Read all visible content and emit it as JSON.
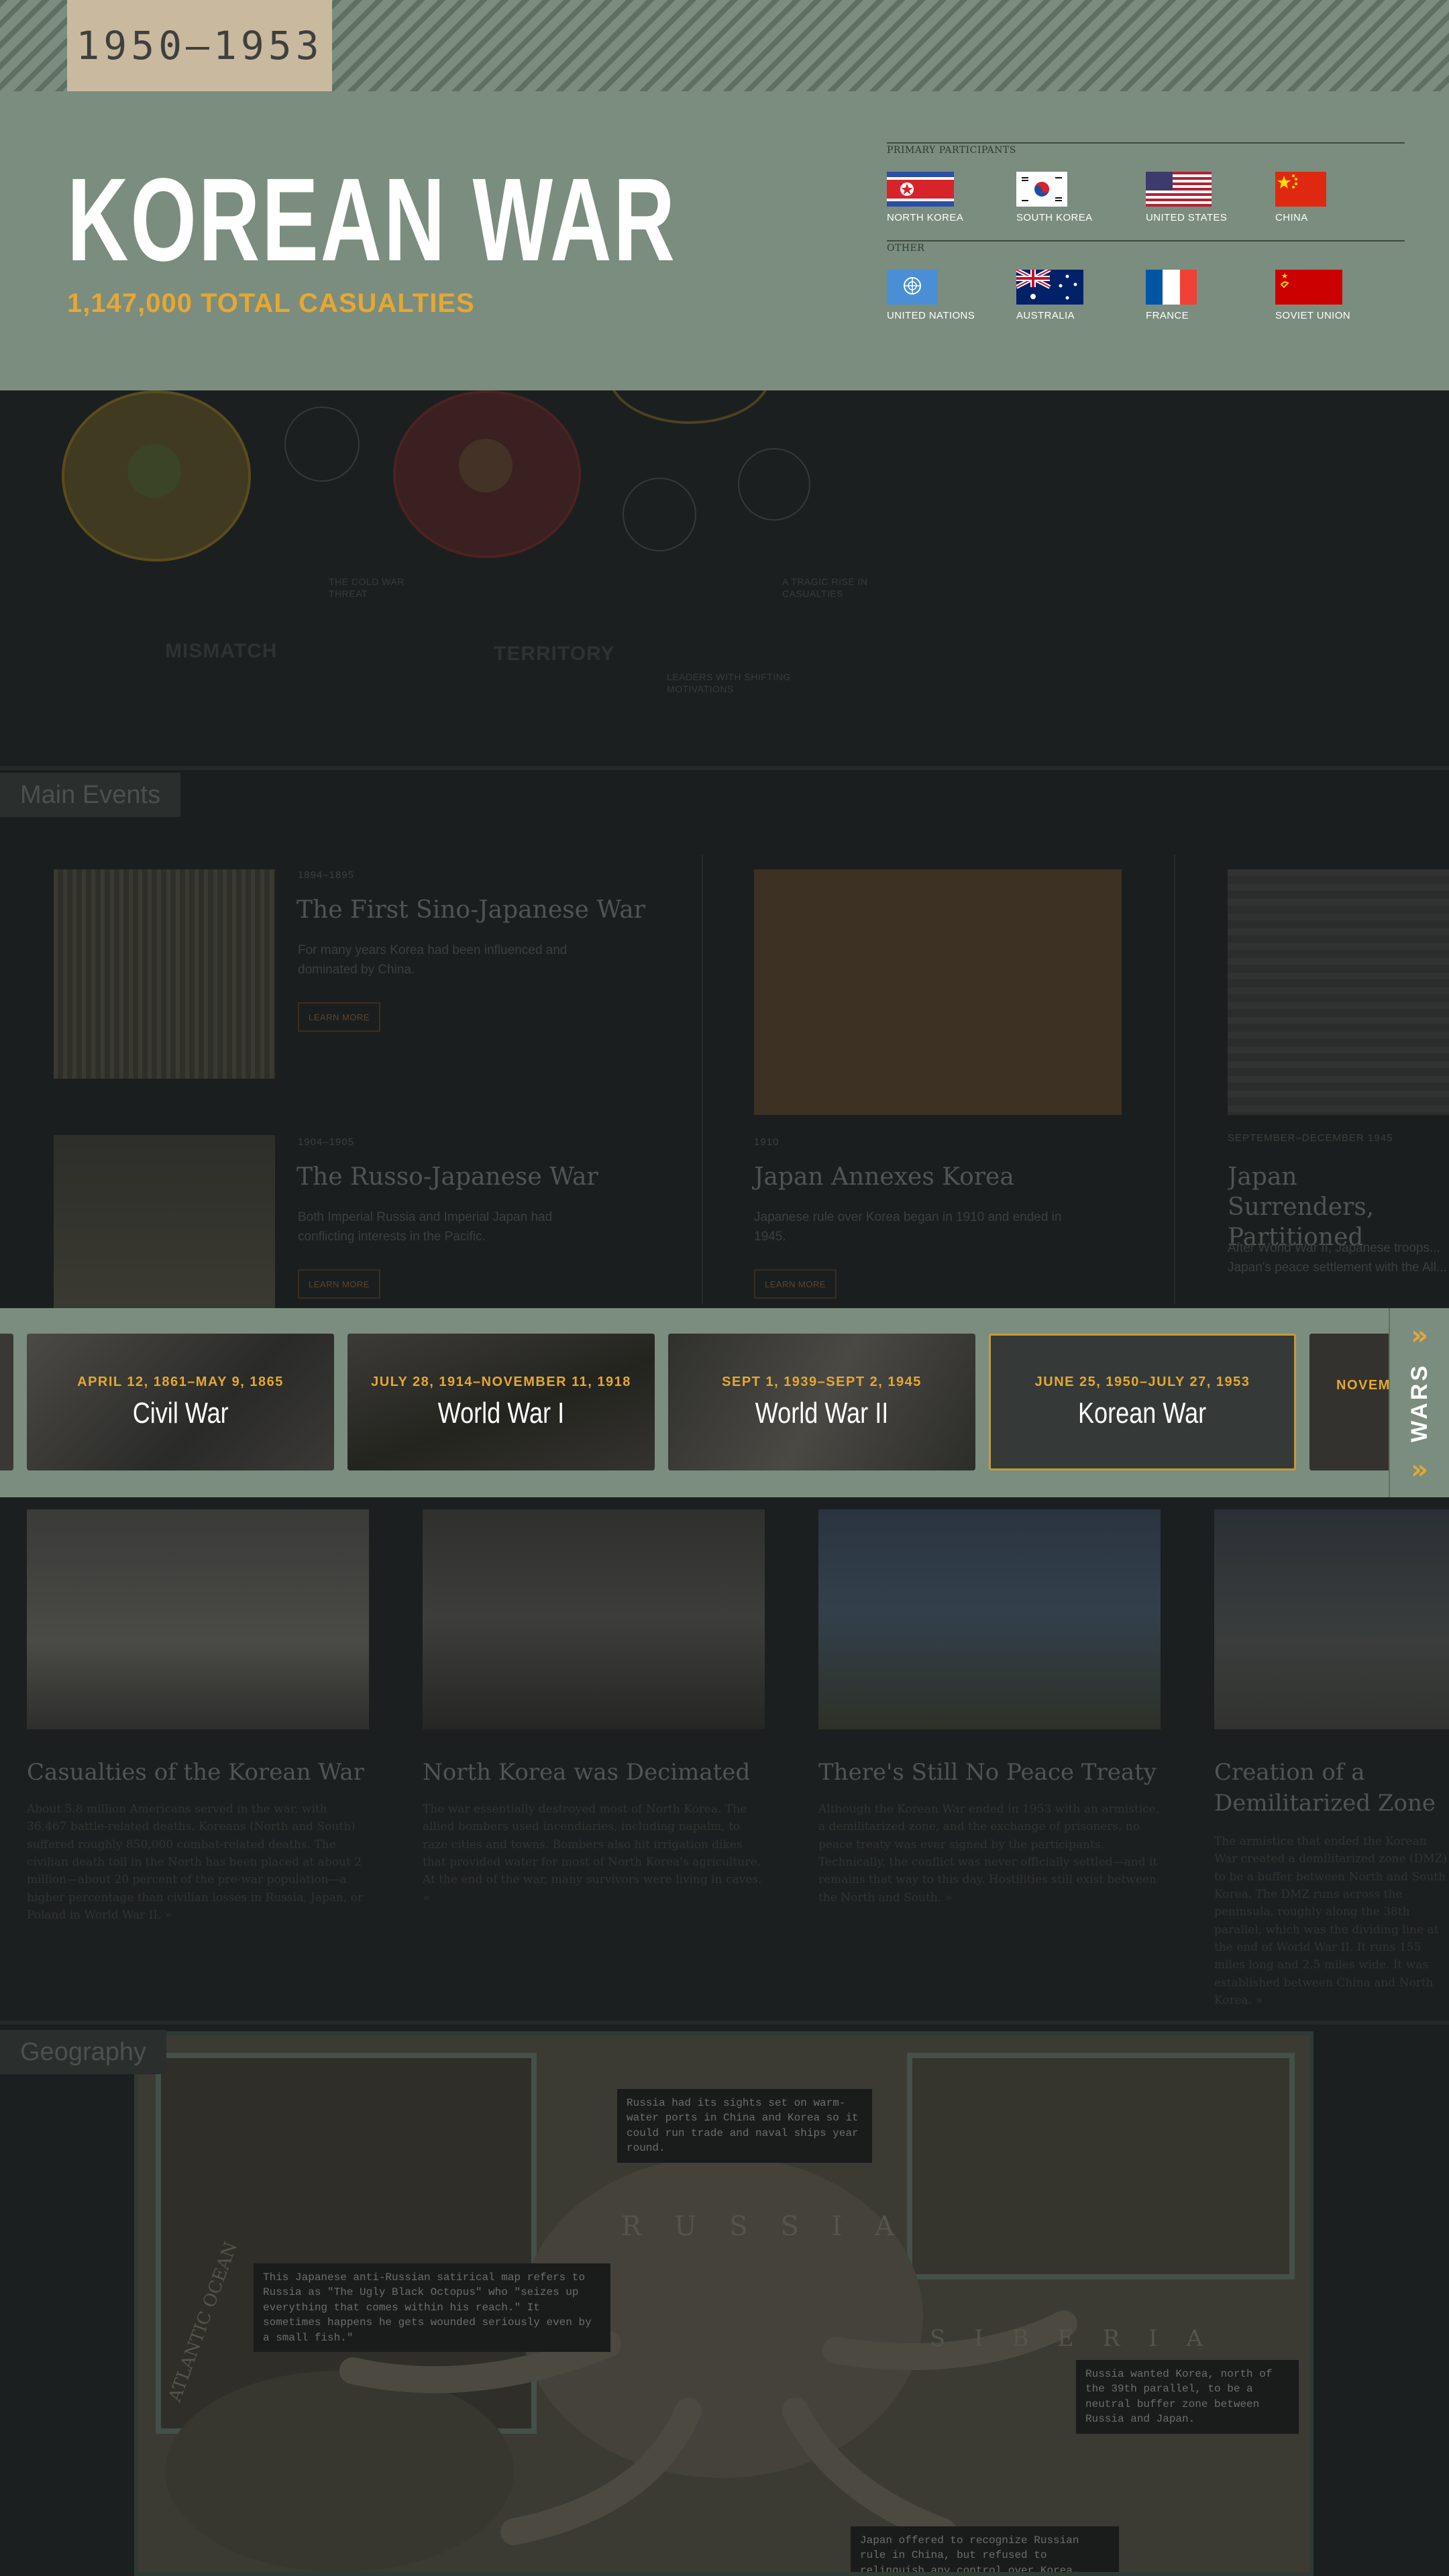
{
  "header": {
    "years": "1950–1953",
    "title": "KOREAN WAR",
    "casualties": "1,147,000 TOTAL CASUALTIES"
  },
  "participants": {
    "primary_label": "PRIMARY PARTICIPANTS",
    "other_label": "OTHER",
    "primary": [
      {
        "name": "NORTH KOREA",
        "flag_icon": "north-korea-flag-icon"
      },
      {
        "name": "SOUTH KOREA",
        "flag_icon": "south-korea-flag-icon"
      },
      {
        "name": "UNITED STATES",
        "flag_icon": "united-states-flag-icon"
      },
      {
        "name": "CHINA",
        "flag_icon": "china-flag-icon"
      }
    ],
    "other": [
      {
        "name": "UNITED NATIONS",
        "flag_icon": "united-nations-flag-icon"
      },
      {
        "name": "AUSTRALIA",
        "flag_icon": "australia-flag-icon"
      },
      {
        "name": "FRANCE",
        "flag_icon": "france-flag-icon"
      },
      {
        "name": "SOVIET UNION",
        "flag_icon": "soviet-union-flag-icon"
      }
    ]
  },
  "graphic": {
    "labels": [
      "MISMATCH",
      "TERRITORY"
    ],
    "small_labels": [
      "THE COLD WAR THREAT",
      "LEADERS WITH SHIFTING MOTIVATIONS",
      "A TRAGIC RISE IN CASUALTIES"
    ]
  },
  "main_events": {
    "section_title": "Main Events",
    "items": [
      {
        "date": "1894–1895",
        "title": "The First Sino-Japanese War",
        "text": "For many years Korea had been influenced and dominated by China.",
        "button": "LEARN MORE"
      },
      {
        "date": "1904–1905",
        "title": "The Russo-Japanese War",
        "text": "Both Imperial Russia and Imperial Japan had conflicting interests in the Pacific.",
        "button": "LEARN MORE"
      },
      {
        "date": "1910",
        "title": "Japan Annexes Korea",
        "text": "Japanese rule over Korea began in 1910 and ended in 1945.",
        "button": "LEARN MORE"
      },
      {
        "date": "SEPTEMBER–DECEMBER 1945",
        "title": "Japan Surrenders, Partitioned",
        "text": "After World War II, Japanese troops... Japan's peace settlement with the All..."
      }
    ]
  },
  "wars": {
    "tab_label": "WARS",
    "items": [
      {
        "dates": "APRIL 12, 1861–MAY 9, 1865",
        "name": "Civil War"
      },
      {
        "dates": "JULY 28, 1914–NOVEMBER 11, 1918",
        "name": "World War I"
      },
      {
        "dates": "SEPT 1, 1939–SEPT 2, 1945",
        "name": "World War II"
      },
      {
        "dates": "JUNE 25, 1950–JULY 27, 1953",
        "name": "Korean War"
      },
      {
        "dates": "NOVEM",
        "name": ""
      }
    ]
  },
  "aftermath": [
    {
      "title": "Casualties of the Korean War",
      "text": "About 5.8 million Americans served in the war, with 36,467 battle-related deaths. Koreans (North and South) suffered roughly 850,000 combat-related deaths. The civilian death toll in the North has been placed at about 2 million—about 20 percent of the pre-war population—a higher percentage than civilian losses in Russia, Japan, or Poland in World War II. »"
    },
    {
      "title": "North Korea was Decimated",
      "text": "The war essentially destroyed most of North Korea. The allied bombers used incendiaries, including napalm, to raze cities and towns. Bombers also hit irrigation dikes that provided water for most of North Korea's agriculture. At the end of the war, many survivors were living in caves. »"
    },
    {
      "title": "There's Still No Peace Treaty",
      "text": "Although the Korean War ended in 1953 with an armistice, a demilitarized zone, and the exchange of prisoners, no peace treaty was ever signed by the participants. Technically, the conflict was never officially settled—and it remains that way to this day. Hostilities still exist between the North and South. »"
    },
    {
      "title": "Creation of a Demilitarized Zone",
      "text": "The armistice that ended the Korean War created a demilitarized zone (DMZ) to be a buffer between North and South Korea. The DMZ runs across the peninsula, roughly along the 38th parallel, which was the dividing line at the end of World War II. It runs 155 miles long and 2.5 miles wide. It was established between China and North Korea. »"
    }
  ],
  "geography": {
    "section_title": "Geography",
    "notes": [
      "Russia had its sights set on warm-water ports in China and Korea so it could run trade and naval ships year round.",
      "This Japanese anti-Russian satirical map refers to Russia as \"The Ugly Black Octopus\" who \"seizes up everything that comes within his reach.\" It sometimes happens he gets wounded seriously even by a small fish.\"",
      "Russia wanted Korea, north of the 39th parallel, to be a neutral buffer zone between Russia and Japan.",
      "Japan offered to recognize Russian rule in China, but refused to relinquish any control over Korea. Russia didn't consider ..."
    ],
    "map_words": [
      "R U S S I A",
      "S I B E R I A",
      "ATLANTIC OCEAN"
    ]
  },
  "colors": {
    "accent": "#e5a832",
    "header_bg": "#7b8d7e",
    "dark_bg": "#1c1f1f",
    "badge_bg": "#c8b99f"
  }
}
